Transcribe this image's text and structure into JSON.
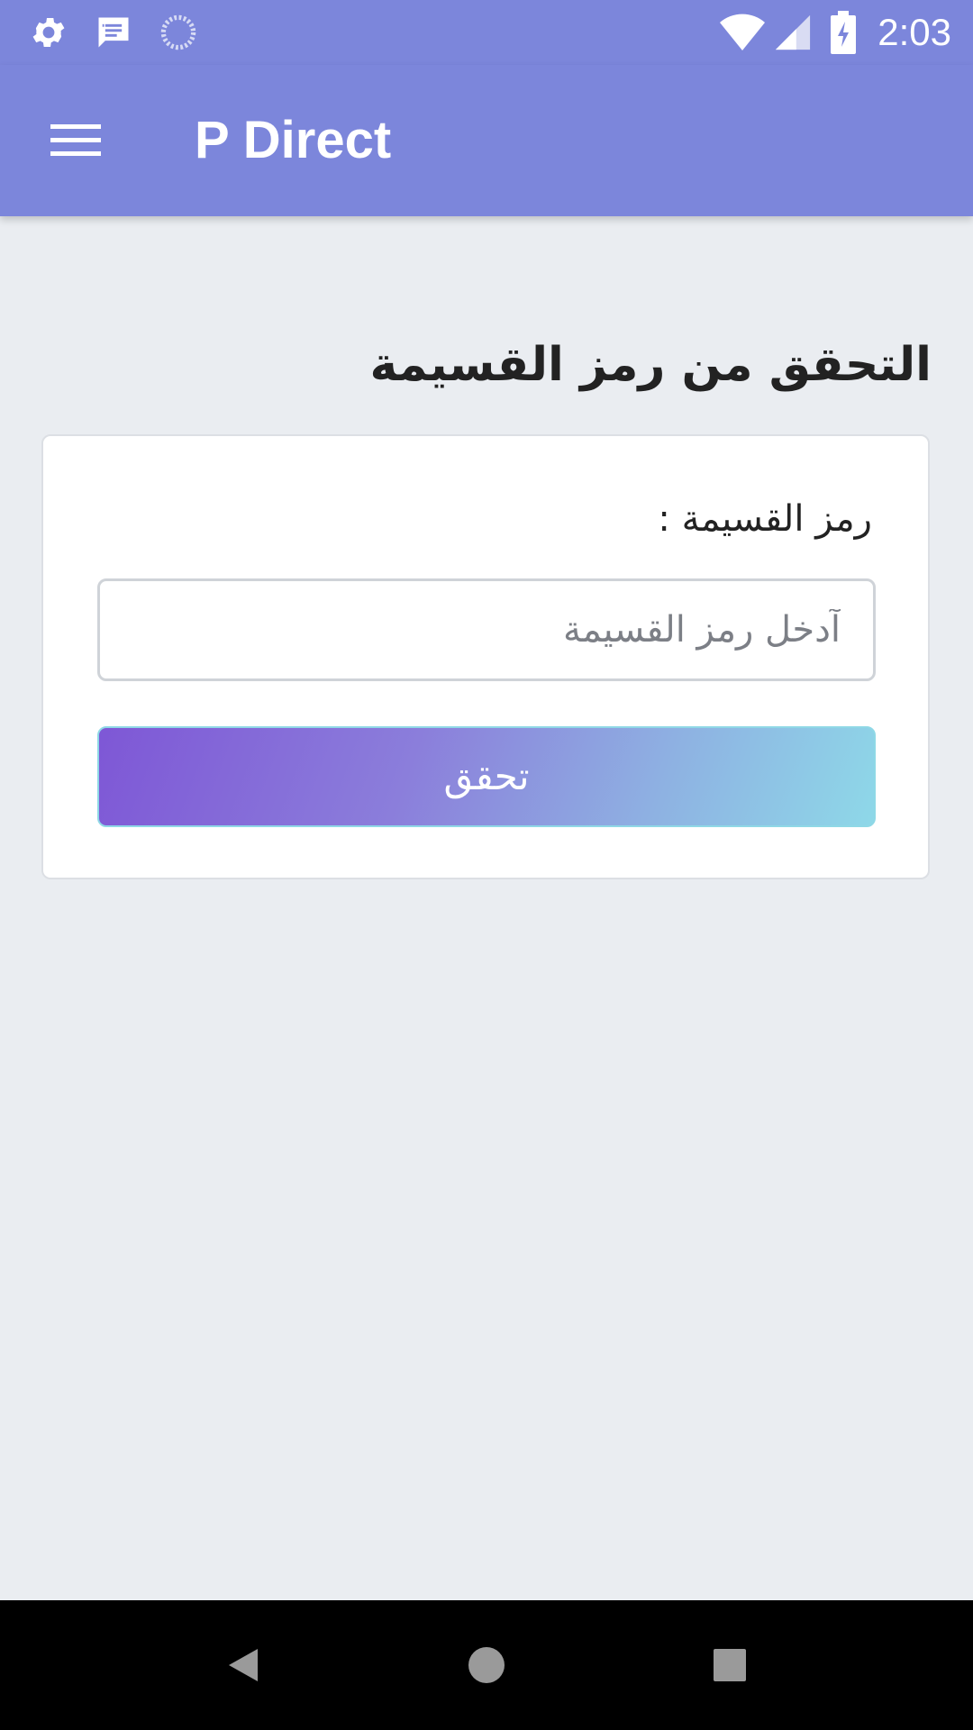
{
  "status_bar": {
    "time": "2:03",
    "left_icons": [
      "gear-icon",
      "message-icon",
      "loading-icon"
    ],
    "right_icons": [
      "wifi-icon",
      "signal-icon",
      "battery-charging-icon"
    ]
  },
  "app_bar": {
    "title": "P Direct",
    "menu_icon": "hamburger-menu-icon",
    "background_color": "#7c86db"
  },
  "page": {
    "title": "التحقق من رمز القسيمة"
  },
  "form": {
    "label": "رمز القسيمة :",
    "input_placeholder": "آدخل رمز القسيمة",
    "input_value": "",
    "submit_label": "تحقق"
  },
  "nav_bar": {
    "buttons": [
      "back-icon",
      "home-icon",
      "recents-icon"
    ]
  }
}
